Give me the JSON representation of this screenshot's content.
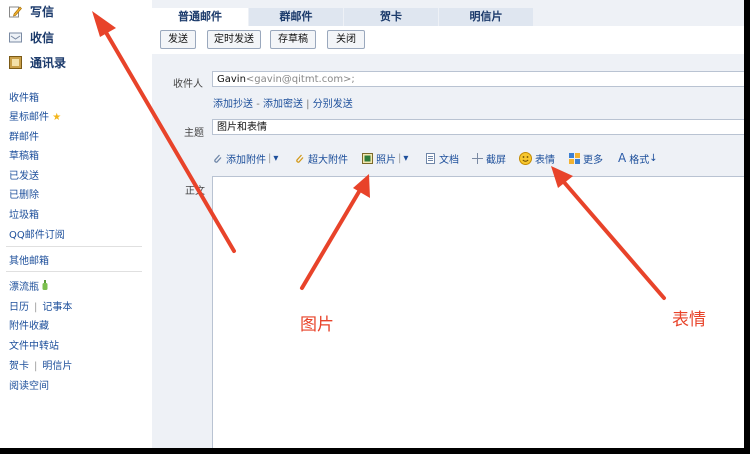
{
  "sidebar": {
    "compose": "写信",
    "inbox": "收信",
    "contacts": "通讯录",
    "folders": [
      {
        "label": "收件箱"
      },
      {
        "label": "星标邮件",
        "star": "★"
      },
      {
        "label": "群邮件"
      },
      {
        "label": "草稿箱"
      },
      {
        "label": "已发送"
      },
      {
        "label": "已删除"
      },
      {
        "label": "垃圾箱"
      },
      {
        "label": "QQ邮件订阅"
      }
    ],
    "other_mailbox": "其他邮箱",
    "drift_bottle": "漂流瓶",
    "calendar": "日历",
    "notebook": "记事本",
    "attachments": "附件收藏",
    "file_transfer": "文件中转站",
    "greeting_card": "贺卡",
    "postcard": "明信片",
    "reading_space": "阅读空间",
    "separator": "|"
  },
  "tabs": [
    "普通邮件",
    "群邮件",
    "贺卡",
    "明信片"
  ],
  "actions": {
    "send": "发送",
    "scheduled": "定时发送",
    "draft": "存草稿",
    "close": "关闭"
  },
  "form": {
    "to_label": "收件人",
    "to_name": "Gavin",
    "to_email": "<gavin@qitmt.com>;",
    "add_cc": "添加抄送",
    "dash": "-",
    "add_bcc": "添加密送",
    "pipe": "|",
    "separate_send": "分别发送",
    "subject_label": "主题",
    "subject_value": "图片和表情",
    "body_label": "正文"
  },
  "toolbar": {
    "attach": "添加附件",
    "big_attach": "超大附件",
    "photo": "照片",
    "doc": "文档",
    "screenshot": "截屏",
    "emoji": "表情",
    "more": "更多",
    "format": "格式",
    "dropdown": "▾",
    "format_arrow": "↓"
  },
  "annotations": {
    "picture": "图片",
    "emoji": "表情"
  },
  "colors": {
    "arrow": "#e8432a",
    "link": "#1d4f9b",
    "background": "#eef1f6"
  }
}
